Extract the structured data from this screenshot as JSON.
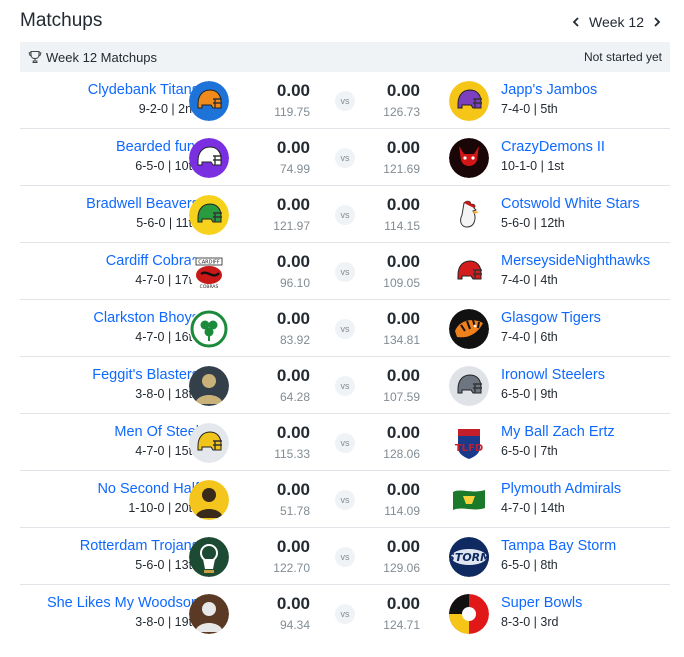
{
  "header": {
    "title": "Matchups",
    "week_label": "Week 12"
  },
  "subbar": {
    "label": "Week 12 Matchups",
    "status": "Not started yet"
  },
  "vs_label": "vs",
  "matchups": [
    {
      "left": {
        "name": "Clydebank Titans",
        "record": "9-2-0 | 2nd",
        "score": "0.00",
        "projected": "119.75",
        "logo": "helmet",
        "color": "#1e73d8",
        "accent": "#f08a1c"
      },
      "right": {
        "name": "Japp's Jambos",
        "record": "7-4-0 | 5th",
        "score": "0.00",
        "projected": "126.73",
        "logo": "helmet",
        "color": "#f5c518",
        "accent": "#7b3fc0"
      }
    },
    {
      "left": {
        "name": "Bearded fury",
        "record": "6-5-0 | 10th",
        "score": "0.00",
        "projected": "74.99",
        "logo": "helmet",
        "color": "#7a2fe0",
        "accent": "#ffffff"
      },
      "right": {
        "name": "CrazyDemons II",
        "record": "10-1-0 | 1st",
        "score": "0.00",
        "projected": "121.69",
        "logo": "demon",
        "color": "#1a0606",
        "accent": "#d01616"
      }
    },
    {
      "left": {
        "name": "Bradwell Beavers",
        "record": "5-6-0 | 11th",
        "score": "0.00",
        "projected": "121.97",
        "logo": "helmet",
        "color": "#f7d21c",
        "accent": "#2a9b3e"
      },
      "right": {
        "name": "Cotswold White Stars",
        "record": "5-6-0 | 12th",
        "score": "0.00",
        "projected": "114.15",
        "logo": "rooster",
        "color": "#ffffff",
        "accent": "#c81818"
      }
    },
    {
      "left": {
        "name": "Cardiff Cobras",
        "record": "4-7-0 | 17th",
        "score": "0.00",
        "projected": "96.10",
        "logo": "badge",
        "color": "#ffffff",
        "accent": "#c81818"
      },
      "right": {
        "name": "MerseysideNighthawks",
        "record": "7-4-0 | 4th",
        "score": "0.00",
        "projected": "109.05",
        "logo": "helmet",
        "color": "#ffffff",
        "accent": "#d41c1c"
      }
    },
    {
      "left": {
        "name": "Clarkston Bhoys",
        "record": "4-7-0 | 16th",
        "score": "0.00",
        "projected": "83.92",
        "logo": "crest",
        "color": "#ffffff",
        "accent": "#1b8a3a"
      },
      "right": {
        "name": "Glasgow Tigers",
        "record": "7-4-0 | 6th",
        "score": "0.00",
        "projected": "134.81",
        "logo": "tiger",
        "color": "#111111",
        "accent": "#f0801c"
      }
    },
    {
      "left": {
        "name": "Feggit's Blasters",
        "record": "3-8-0 | 18th",
        "score": "0.00",
        "projected": "64.28",
        "logo": "photo",
        "color": "#33404a",
        "accent": "#c9b27a"
      },
      "right": {
        "name": "Ironowl Steelers",
        "record": "6-5-0 | 9th",
        "score": "0.00",
        "projected": "107.59",
        "logo": "helmet",
        "color": "#dfe3e8",
        "accent": "#6d7680"
      }
    },
    {
      "left": {
        "name": "Men Of Steel",
        "record": "4-7-0 | 15th",
        "score": "0.00",
        "projected": "115.33",
        "logo": "helmet",
        "color": "#e4e8ec",
        "accent": "#f0c41a"
      },
      "right": {
        "name": "My Ball Zach Ertz",
        "record": "6-5-0 | 7th",
        "score": "0.00",
        "projected": "128.06",
        "logo": "shield",
        "color": "#ffffff",
        "accent": "#1a3a8c"
      }
    },
    {
      "left": {
        "name": "No Second Half",
        "record": "1-10-0 | 20th",
        "score": "0.00",
        "projected": "51.78",
        "logo": "photo",
        "color": "#f4c51c",
        "accent": "#3a2a1a"
      },
      "right": {
        "name": "Plymouth Admirals",
        "record": "4-7-0 | 14th",
        "score": "0.00",
        "projected": "114.09",
        "logo": "flag",
        "color": "#ffffff",
        "accent": "#1a7a2a"
      }
    },
    {
      "left": {
        "name": "Rotterdam Trojans",
        "record": "5-6-0 | 13th",
        "score": "0.00",
        "projected": "122.70",
        "logo": "trojan",
        "color": "#1d4a32",
        "accent": "#ffffff"
      },
      "right": {
        "name": "Tampa Bay Storm",
        "record": "6-5-0 | 8th",
        "score": "0.00",
        "projected": "129.06",
        "logo": "storm",
        "color": "#0f2a60",
        "accent": "#ffffff"
      }
    },
    {
      "left": {
        "name": "She Likes My Woodson",
        "record": "3-8-0 | 19th",
        "score": "0.00",
        "projected": "94.34",
        "logo": "photo",
        "color": "#5a3a24",
        "accent": "#e8e8e8"
      },
      "right": {
        "name": "Super Bowls",
        "record": "8-3-0 | 3rd",
        "score": "0.00",
        "projected": "124.71",
        "logo": "bowl",
        "color": "#e01818",
        "accent": "#f5c518"
      }
    }
  ]
}
